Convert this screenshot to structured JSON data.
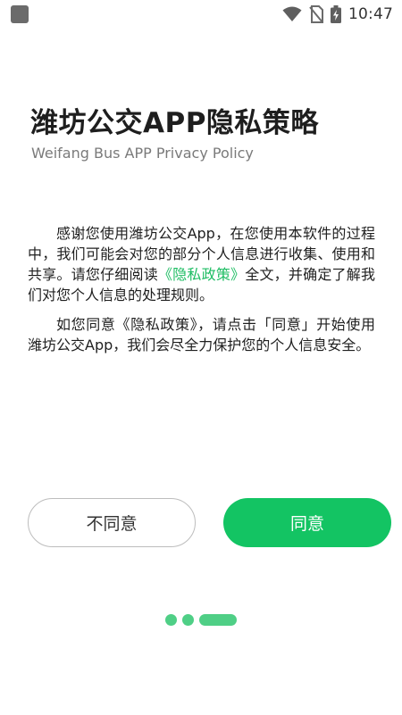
{
  "status_bar": {
    "time": "10:47"
  },
  "header": {
    "title": "潍坊公交APP隐私策略",
    "subtitle": "Weifang Bus APP Privacy Policy"
  },
  "body": {
    "p1_part1": "感谢您使用潍坊公交App，在您使用本软件的过程中，我们可能会对您的部分个人信息进行收集、使用和共享。请您仔细阅读",
    "p1_link": "《隐私政策》",
    "p1_part2": "全文，并确定了解我们对您个人信息的处理规则。",
    "p2": "如您同意《隐私政策》，请点击「同意」开始使用潍坊公交App，我们会尽全力保护您的个人信息安全。"
  },
  "buttons": {
    "disagree_label": "不同意",
    "agree_label": "同意"
  },
  "pager": {
    "current_page": 3,
    "total_pages": 3
  },
  "colors": {
    "accent": "#13c463",
    "link": "#1ebd63",
    "indicator": "#4fcf86"
  }
}
